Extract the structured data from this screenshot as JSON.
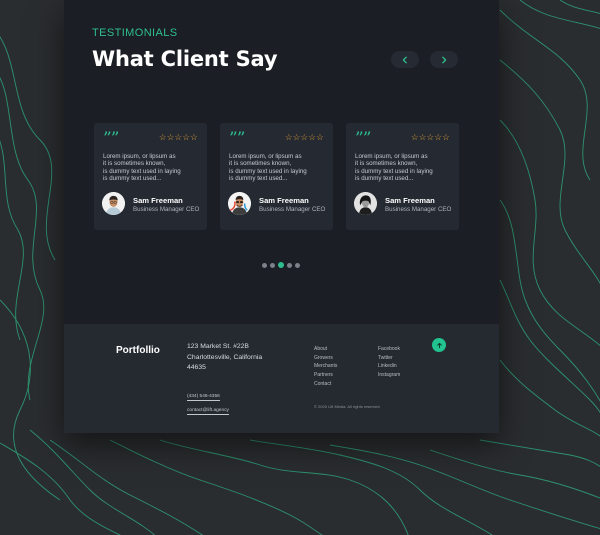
{
  "testimonials": {
    "kicker": "TESTIMONIALS",
    "title": "What Client Say",
    "prev_icon": "chevron-left-icon",
    "next_icon": "chevron-right-icon",
    "cards": [
      {
        "quote": "””",
        "stars": "☆☆☆☆☆",
        "rating": 5,
        "text": [
          "Lorem ipsum, or lipsum as",
          "it is sometimes known,",
          "is dummy text used in laying",
          "is dummy text used..."
        ],
        "name": "Sam Freeman",
        "role": "Business Manager CEO",
        "avatar": "avatar-man-glasses"
      },
      {
        "quote": "””",
        "stars": "☆☆☆☆☆",
        "rating": 5,
        "text": [
          "Lorem ipsum, or lipsum as",
          "it is sometimes known,",
          "is dummy text used in laying",
          "is dummy text used..."
        ],
        "name": "Sam Freeman",
        "role": "Business Manager CEO",
        "avatar": "avatar-man-sunglasses"
      },
      {
        "quote": "””",
        "stars": "☆☆☆☆☆",
        "rating": 5,
        "text": [
          "Lorem ipsum, or lipsum as",
          "it is sometimes known,",
          "is dummy text used in laying",
          "is dummy text used..."
        ],
        "name": "Sam Freeman",
        "role": "Business Manager CEO",
        "avatar": "avatar-woman-bw"
      }
    ],
    "pagination": {
      "count": 5,
      "active_index": 2
    }
  },
  "footer": {
    "brand": "Portfollio",
    "address": [
      "123 Market St. #22B",
      "Charlottesville, California",
      "44635"
    ],
    "phone": "(434) 546-4356",
    "email": "contact@lift.agency",
    "links_col1": [
      "About",
      "Growers",
      "Merchants",
      "Partners",
      "Contact"
    ],
    "links_col2": [
      "Facebook",
      "Twitter",
      "Linkedin",
      "Instagram"
    ],
    "copyright": "© 2020 Lift Media. All rights reserved.",
    "to_top_icon": "arrow-up-icon"
  },
  "colors": {
    "accent": "#2fbf8f",
    "panel": "#1b1e24",
    "card": "#242932",
    "footer": "#252a30",
    "star": "#e6a43a",
    "background": "#2a2d2f"
  }
}
